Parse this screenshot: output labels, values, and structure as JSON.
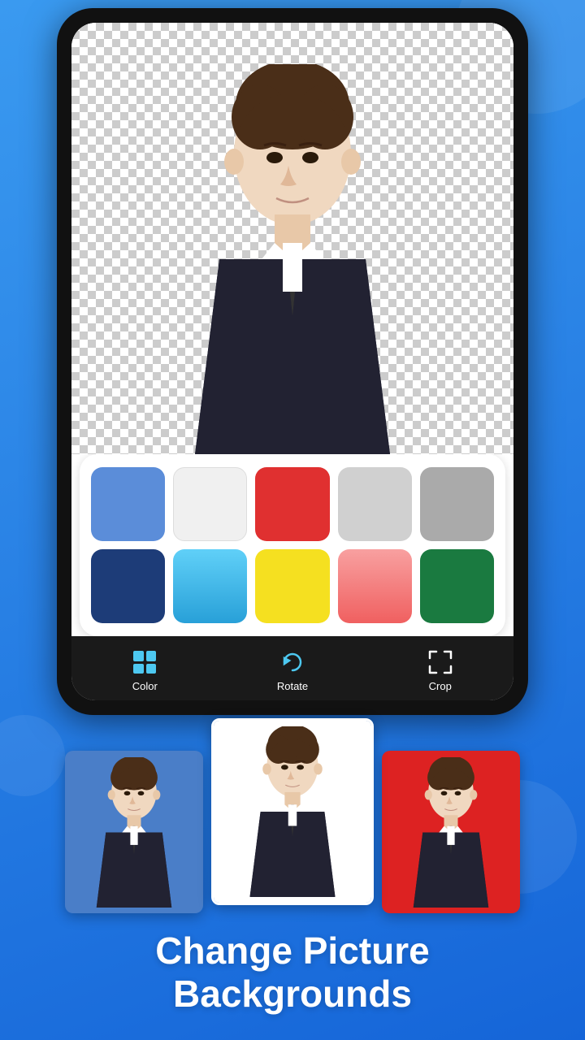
{
  "app": {
    "title": "Change Picture Backgrounds"
  },
  "colors": {
    "top_row": [
      {
        "name": "blue",
        "value": "#5b8dd9"
      },
      {
        "name": "white",
        "value": "#f0f0f0"
      },
      {
        "name": "red",
        "value": "#e03030"
      },
      {
        "name": "light-gray",
        "value": "#d0d0d0"
      },
      {
        "name": "gray",
        "value": "#aaaaaa"
      }
    ],
    "bottom_row": [
      {
        "name": "dark-blue",
        "value": "#1d3c78"
      },
      {
        "name": "sky-blue",
        "value": "#38b6e8"
      },
      {
        "name": "yellow",
        "value": "#f5e020"
      },
      {
        "name": "pink",
        "value": "#f08080"
      },
      {
        "name": "green",
        "value": "#1a7a40"
      }
    ]
  },
  "toolbar": {
    "items": [
      {
        "id": "color",
        "label": "Color"
      },
      {
        "id": "rotate",
        "label": "Rotate"
      },
      {
        "id": "crop",
        "label": "Crop"
      }
    ]
  },
  "previews": [
    {
      "bg": "#4a7ec8",
      "position": "left"
    },
    {
      "bg": "#ffffff",
      "position": "center"
    },
    {
      "bg": "#dd2222",
      "position": "right"
    }
  ],
  "headline": {
    "line1": "Change Picture",
    "line2": "Backgrounds"
  }
}
